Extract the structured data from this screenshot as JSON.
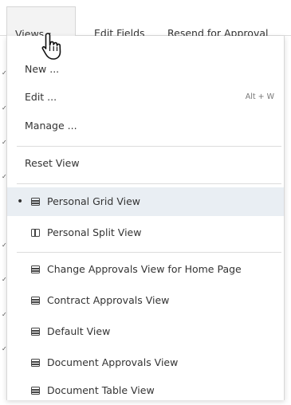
{
  "toolbar": {
    "views_label": "Views",
    "views_caret": "▾",
    "edit_fields_label": "Edit Fields",
    "resend_label": "Resend for Approval"
  },
  "menu": {
    "new_label": "New ...",
    "edit_label": "Edit ...",
    "edit_shortcut": "Alt + W",
    "manage_label": "Manage ...",
    "reset_label": "Reset View",
    "personal_grid_label": "Personal Grid View",
    "personal_split_label": "Personal Split View",
    "views": [
      "Change Approvals View for Home Page",
      "Contract Approvals View",
      "Default View",
      "Document Approvals View",
      "Document Table View"
    ],
    "selected_bullet": "•"
  },
  "colors": {
    "selected_bg": "#e9eef3",
    "separator": "#dcdcdc",
    "text": "#333333"
  }
}
